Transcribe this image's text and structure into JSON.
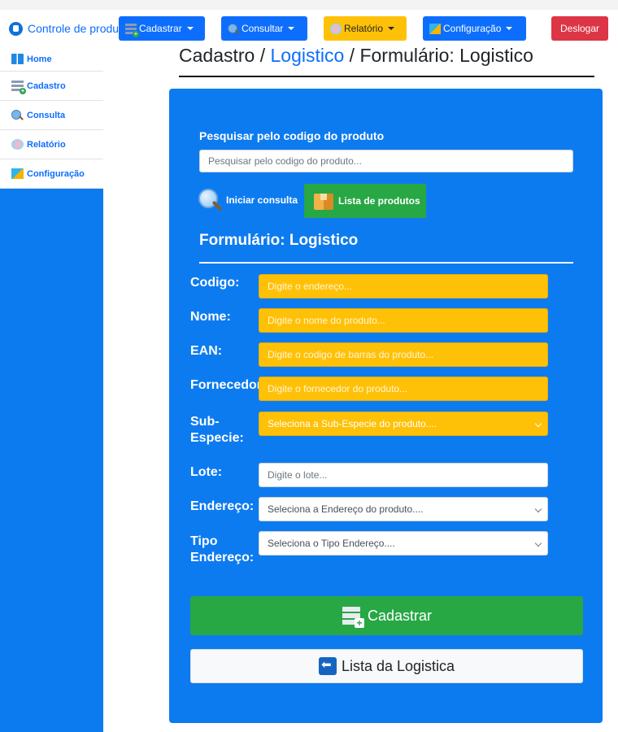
{
  "app": {
    "brand": "Controle de produ"
  },
  "sidebar": {
    "items": [
      {
        "label": "Home",
        "icon": "home-icon"
      },
      {
        "label": "Cadastro",
        "icon": "add-database-icon"
      },
      {
        "label": "Consulta",
        "icon": "magnifier-icon"
      },
      {
        "label": "Relatório",
        "icon": "report-icon"
      },
      {
        "label": "Configuração",
        "icon": "settings-icon"
      }
    ]
  },
  "navbar": {
    "cadastrar": "Cadastrar",
    "consultar": "Consultar",
    "relatorio": "Relatório",
    "configuracao": "Configuração",
    "deslogar": "Deslogar"
  },
  "breadcrumb": {
    "part1": "Cadastro / ",
    "link": "Logistico",
    "part2": " / Formulário: Logistico"
  },
  "search": {
    "label": "Pesquisar pelo codigo do produto",
    "placeholder": "Pesquisar pelo codigo do produto...",
    "start_button": "Iniciar consulta",
    "list_button": "Lista de produtos"
  },
  "form": {
    "title": "Formulário: Logistico",
    "fields": [
      {
        "label": "Codigo:",
        "placeholder": "Digite o endereço..."
      },
      {
        "label": "Nome:",
        "placeholder": "Digite o nome do produto..."
      },
      {
        "label": "EAN:",
        "placeholder": "Digite o codigo de barras do produto..."
      },
      {
        "label": "Fornecedor:",
        "placeholder": "Digite o fornecedor do produto..."
      },
      {
        "label_line1": "Sub-",
        "label_line2": "Especie:",
        "selected": "Seleciona a Sub-Especie do produto...."
      },
      {
        "label": "Lote:",
        "placeholder": "Digite o lote..."
      },
      {
        "label": "Endereço:",
        "selected": "Seleciona a Endereço do produto...."
      },
      {
        "label_line1": "Tipo",
        "label_line2": "Endereço:",
        "selected": "Seleciona o Tipo Endereço...."
      }
    ],
    "submit": "Cadastrar",
    "back": "Lista da Logistica"
  },
  "colors": {
    "primary": "#0d6efd",
    "panel": "#0d7bf0",
    "warning": "#ffc107",
    "success": "#28a745",
    "danger": "#dc3545"
  }
}
